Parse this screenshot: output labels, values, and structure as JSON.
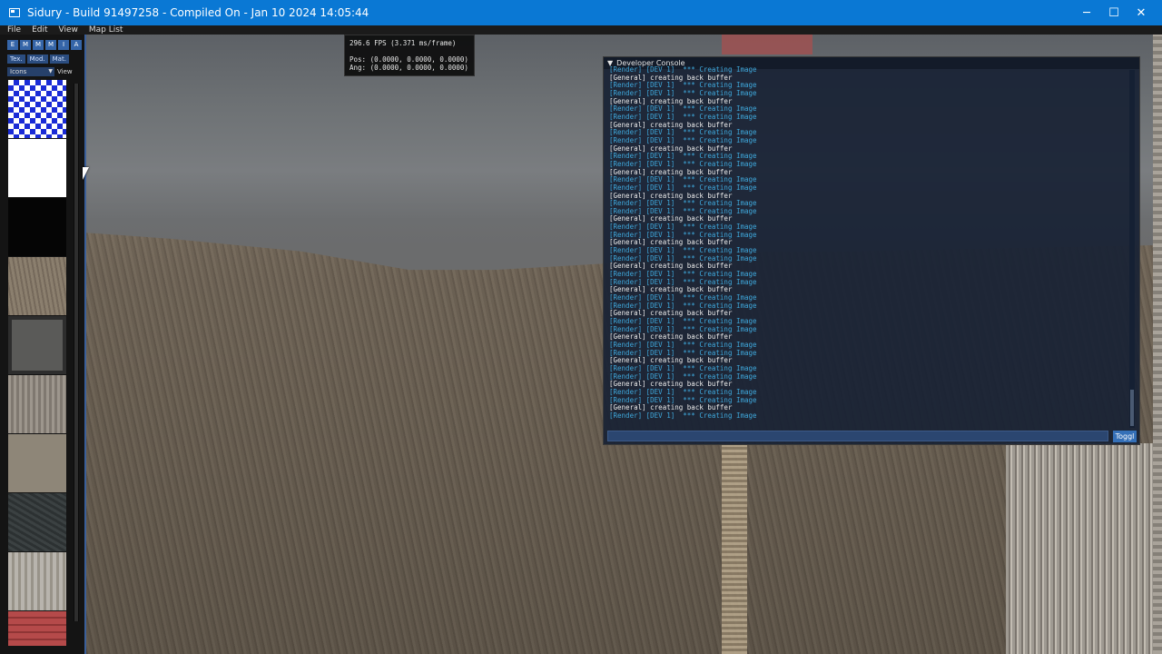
{
  "window": {
    "title": "Sidury - Build 91497258 - Compiled On - Jan 10 2024 14:05:44",
    "controls": {
      "minimize": "─",
      "maximize": "☐",
      "close": "✕"
    }
  },
  "menubar": {
    "items": [
      "File",
      "Edit",
      "View",
      "Map List"
    ]
  },
  "left_panel": {
    "toolbar_buttons": [
      "E",
      "M",
      "M",
      "M",
      "I",
      "A"
    ],
    "tabs": [
      "Tex.",
      "Mod.",
      "Mat."
    ],
    "icons_dropdown": "Icons",
    "view_label": "View"
  },
  "stats": {
    "fps": "296.6 FPS (3.371 ms/frame)",
    "pos": "Pos: (0.0000, 0.0000, 0.0000)",
    "ang": "Ang: (0.0000, 0.0000, 0.0000)"
  },
  "console": {
    "title": "Developer Console",
    "toggle_label": "Toggl",
    "input_value": "",
    "lines": [
      {
        "type": "render",
        "text": "[Render] [DEV 1]  *** Creating Image"
      },
      {
        "type": "general",
        "text": "[General] creating back buffer"
      },
      {
        "type": "render",
        "text": "[Render] [DEV 1]  *** Creating Image"
      },
      {
        "type": "render",
        "text": "[Render] [DEV 1]  *** Creating Image"
      },
      {
        "type": "general",
        "text": "[General] creating back buffer"
      },
      {
        "type": "render",
        "text": "[Render] [DEV 1]  *** Creating Image"
      },
      {
        "type": "render",
        "text": "[Render] [DEV 1]  *** Creating Image"
      },
      {
        "type": "general",
        "text": "[General] creating back buffer"
      },
      {
        "type": "render",
        "text": "[Render] [DEV 1]  *** Creating Image"
      },
      {
        "type": "render",
        "text": "[Render] [DEV 1]  *** Creating Image"
      },
      {
        "type": "general",
        "text": "[General] creating back buffer"
      },
      {
        "type": "render",
        "text": "[Render] [DEV 1]  *** Creating Image"
      },
      {
        "type": "render",
        "text": "[Render] [DEV 1]  *** Creating Image"
      },
      {
        "type": "general",
        "text": "[General] creating back buffer"
      },
      {
        "type": "render",
        "text": "[Render] [DEV 1]  *** Creating Image"
      },
      {
        "type": "render",
        "text": "[Render] [DEV 1]  *** Creating Image"
      },
      {
        "type": "general",
        "text": "[General] creating back buffer"
      },
      {
        "type": "render",
        "text": "[Render] [DEV 1]  *** Creating Image"
      },
      {
        "type": "render",
        "text": "[Render] [DEV 1]  *** Creating Image"
      },
      {
        "type": "general",
        "text": "[General] creating back buffer"
      },
      {
        "type": "render",
        "text": "[Render] [DEV 1]  *** Creating Image"
      },
      {
        "type": "render",
        "text": "[Render] [DEV 1]  *** Creating Image"
      },
      {
        "type": "general",
        "text": "[General] creating back buffer"
      },
      {
        "type": "render",
        "text": "[Render] [DEV 1]  *** Creating Image"
      },
      {
        "type": "render",
        "text": "[Render] [DEV 1]  *** Creating Image"
      },
      {
        "type": "general",
        "text": "[General] creating back buffer"
      },
      {
        "type": "render",
        "text": "[Render] [DEV 1]  *** Creating Image"
      },
      {
        "type": "render",
        "text": "[Render] [DEV 1]  *** Creating Image"
      },
      {
        "type": "general",
        "text": "[General] creating back buffer"
      },
      {
        "type": "render",
        "text": "[Render] [DEV 1]  *** Creating Image"
      },
      {
        "type": "render",
        "text": "[Render] [DEV 1]  *** Creating Image"
      },
      {
        "type": "general",
        "text": "[General] creating back buffer"
      },
      {
        "type": "render",
        "text": "[Render] [DEV 1]  *** Creating Image"
      },
      {
        "type": "render",
        "text": "[Render] [DEV 1]  *** Creating Image"
      },
      {
        "type": "general",
        "text": "[General] creating back buffer"
      },
      {
        "type": "render",
        "text": "[Render] [DEV 1]  *** Creating Image"
      },
      {
        "type": "render",
        "text": "[Render] [DEV 1]  *** Creating Image"
      },
      {
        "type": "general",
        "text": "[General] creating back buffer"
      },
      {
        "type": "render",
        "text": "[Render] [DEV 1]  *** Creating Image"
      },
      {
        "type": "render",
        "text": "[Render] [DEV 1]  *** Creating Image"
      },
      {
        "type": "general",
        "text": "[General] creating back buffer"
      },
      {
        "type": "render",
        "text": "[Render] [DEV 1]  *** Creating Image"
      },
      {
        "type": "render",
        "text": "[Render] [DEV 1]  *** Creating Image"
      },
      {
        "type": "general",
        "text": "[General] creating back buffer"
      },
      {
        "type": "render",
        "text": "[Render] [DEV 1]  *** Creating Image"
      }
    ]
  },
  "colors": {
    "titlebar": "#0a78d4",
    "console_render": "#3fa9dd",
    "console_general": "#eaeaea",
    "accent": "#3570b8"
  }
}
